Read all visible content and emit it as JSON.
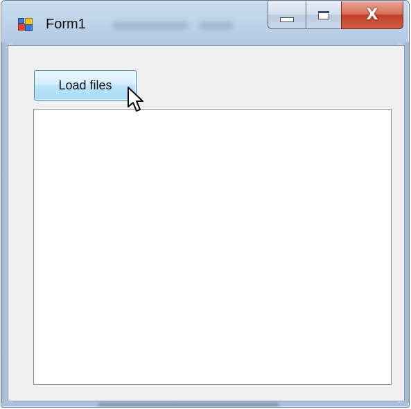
{
  "window": {
    "title": "Form1",
    "app_icon": "winforms-app-icon"
  },
  "caption_buttons": {
    "minimize_icon": "minimize-icon",
    "maximize_icon": "maximize-icon",
    "close_icon": "close-icon",
    "close_glyph": "X"
  },
  "toolbar": {
    "load_label": "Load files"
  },
  "file_list": {
    "items": []
  },
  "colors": {
    "button_border": "#3c7fb1",
    "button_hover_top": "#eaf6fd",
    "button_hover_bottom": "#a7d9f5",
    "close_button_red": "#c1402a",
    "client_background": "#f0f0f0",
    "frame_blue": "#bcd1e7"
  }
}
